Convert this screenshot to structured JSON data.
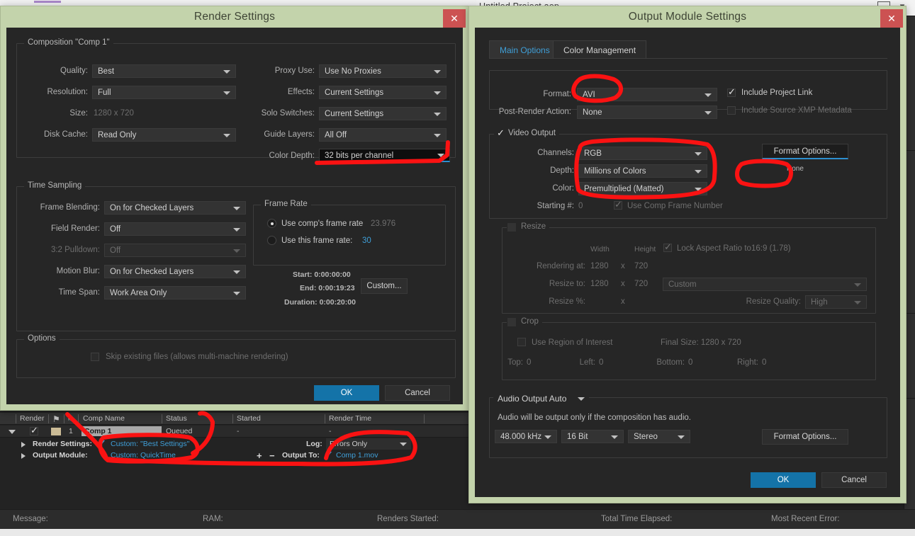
{
  "window": {
    "project_title": "Untitled Project.aep",
    "minimize_icon": "minimize-icon",
    "chevron_icon": "chevron-down-icon"
  },
  "render_settings": {
    "title": "Render Settings",
    "close_label": "✕",
    "composition_group": "Composition \"Comp 1\"",
    "left_fields": [
      {
        "label": "Quality:",
        "value": "Best",
        "type": "dropdown"
      },
      {
        "label": "Resolution:",
        "value": "Full",
        "type": "dropdown"
      },
      {
        "label": "Size:",
        "value": "1280 x 720",
        "type": "text"
      },
      {
        "label": "Disk Cache:",
        "value": "Read Only",
        "type": "dropdown"
      }
    ],
    "right_fields": [
      {
        "label": "Proxy Use:",
        "value": "Use No Proxies",
        "type": "dropdown"
      },
      {
        "label": "Effects:",
        "value": "Current Settings",
        "type": "dropdown"
      },
      {
        "label": "Solo Switches:",
        "value": "Current Settings",
        "type": "dropdown"
      },
      {
        "label": "Guide Layers:",
        "value": "All Off",
        "type": "dropdown"
      },
      {
        "label": "Color Depth:",
        "value": "32 bits per channel",
        "type": "dropdown-focused"
      }
    ],
    "time_sampling_group": "Time Sampling",
    "time_fields": [
      {
        "label": "Frame Blending:",
        "value": "On for Checked Layers",
        "disabled": false
      },
      {
        "label": "Field Render:",
        "value": "Off",
        "disabled": false
      },
      {
        "label": "3:2 Pulldown:",
        "value": "Off",
        "disabled": true
      },
      {
        "label": "Motion Blur:",
        "value": "On for Checked Layers",
        "disabled": false
      },
      {
        "label": "Time Span:",
        "value": "Work Area Only",
        "disabled": false
      }
    ],
    "frame_rate_group": "Frame Rate",
    "frame_rate_option_comp": "Use comp's frame rate",
    "frame_rate_comp_value": "23.976",
    "frame_rate_option_custom": "Use this frame rate:",
    "frame_rate_custom_value": "30",
    "frame_rate_selected": "comp",
    "start_label": "Start: 0:00:00:00",
    "end_label": "End: 0:00:19:23",
    "duration_label": "Duration: 0:00:20:00",
    "custom_button": "Custom...",
    "options_group": "Options",
    "skip_existing_label": "Skip existing files (allows multi-machine rendering)",
    "skip_existing_checked": false,
    "ok_button": "OK",
    "cancel_button": "Cancel"
  },
  "output_module": {
    "title": "Output Module Settings",
    "close_label": "✕",
    "tabs": [
      {
        "label": "Main Options",
        "active": true
      },
      {
        "label": "Color Management",
        "active": false
      }
    ],
    "format_label": "Format:",
    "format_value": "AVI",
    "post_render_label": "Post-Render Action:",
    "post_render_value": "None",
    "include_project_link_label": "Include Project Link",
    "include_project_link_checked": true,
    "include_xmp_label": "Include Source XMP Metadata",
    "include_xmp_checked": false,
    "video_output_group": "Video Output",
    "video_output_checked": true,
    "channels_label": "Channels:",
    "channels_value": "RGB",
    "depth_label": "Depth:",
    "depth_value": "Millions of Colors",
    "color_label": "Color:",
    "color_value": "Premultiplied (Matted)",
    "starting_num_label": "Starting #:",
    "starting_num_value": "0",
    "use_comp_frame_number_label": "Use Comp Frame Number",
    "use_comp_frame_number_checked": true,
    "format_options_button": "Format Options...",
    "format_options_status": "None",
    "resize_group": "Resize",
    "resize_checked": false,
    "width_header": "Width",
    "height_header": "Height",
    "lock_aspect_label": "Lock Aspect Ratio to",
    "lock_aspect_value": "16:9 (1.78)",
    "lock_aspect_checked": true,
    "rendering_at_label": "Rendering at:",
    "rendering_at_width": "1280",
    "rendering_at_height": "720",
    "resize_to_label": "Resize to:",
    "resize_to_width": "1280",
    "resize_to_height": "720",
    "resize_preset_value": "Custom",
    "resize_pct_label": "Resize %:",
    "resize_quality_label": "Resize Quality:",
    "resize_quality_value": "High",
    "x_separator": "x",
    "crop_group": "Crop",
    "crop_checked": false,
    "use_roi_label": "Use Region of Interest",
    "use_roi_checked": false,
    "final_size_label": "Final Size: 1280 x 720",
    "crop_fields": [
      {
        "label": "Top:",
        "value": "0"
      },
      {
        "label": "Left:",
        "value": "0"
      },
      {
        "label": "Bottom:",
        "value": "0"
      },
      {
        "label": "Right:",
        "value": "0"
      }
    ],
    "audio_output_value": "Audio Output Auto",
    "audio_note": "Audio will be output only if the composition has audio.",
    "audio_rate": "48.000 kHz",
    "audio_bit": "16 Bit",
    "audio_channels": "Stereo",
    "audio_format_options_button": "Format Options...",
    "ok_button": "OK",
    "cancel_button": "Cancel"
  },
  "render_queue": {
    "columns": [
      "Render",
      "⚑",
      "#",
      "Comp Name",
      "Status",
      "Started",
      "Render Time"
    ],
    "row": {
      "render_checked": true,
      "index": "1",
      "comp_name": "Comp 1",
      "status": "Queued",
      "started": "-",
      "render_time": "-"
    },
    "render_settings_label": "Render Settings:",
    "render_settings_value": "Custom: \"Best Settings\"",
    "log_label": "Log:",
    "log_value": "Errors Only",
    "output_module_label": "Output Module:",
    "output_module_value": "Custom: QuickTime",
    "plus_label": "+",
    "minus_label": "−",
    "output_to_label": "Output To:",
    "output_to_value": "Comp 1.mov"
  },
  "status_bar": {
    "items": [
      "Message:",
      "RAM:",
      "Renders Started:",
      "Total Time Elapsed:",
      "Most Recent Error:"
    ]
  },
  "colors": {
    "dialog_titlebar": "#c3d3ab",
    "dialog_body": "#262626",
    "accent_blue": "#1473a8",
    "link_blue": "#3f9fd8",
    "close_red": "#cc5252",
    "annotation_red": "#fa1212"
  }
}
